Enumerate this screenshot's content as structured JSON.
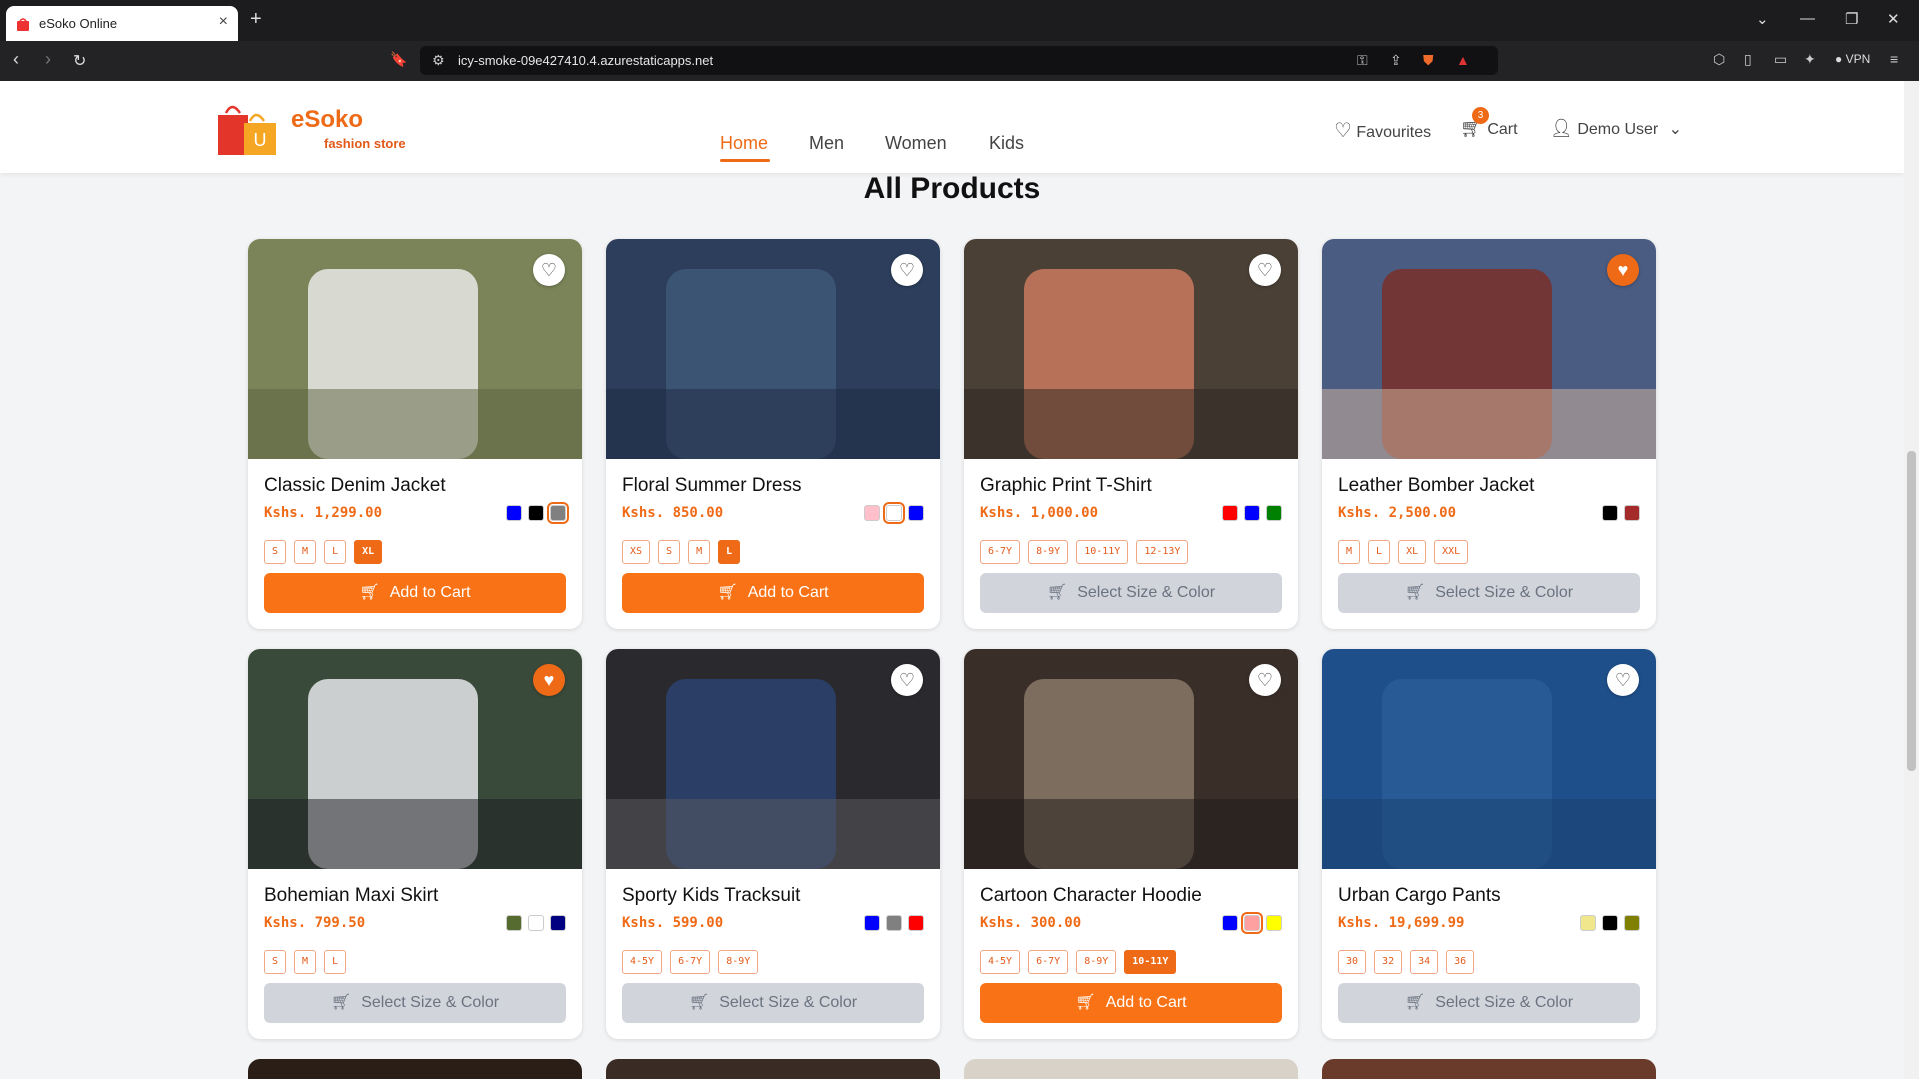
{
  "browser": {
    "tab_title": "eSoko Online",
    "url": "icy-smoke-09e427410.4.azurestaticapps.net",
    "vpn_label": "VPN"
  },
  "header": {
    "brand": "eSoko",
    "tagline": "fashion store",
    "nav": [
      "Home",
      "Men",
      "Women",
      "Kids"
    ],
    "active_nav": "Home",
    "favourites_label": "Favourites",
    "cart_label": "Cart",
    "cart_count": "3",
    "user_label": "Demo User"
  },
  "main": {
    "title": "All Products",
    "products": [
      {
        "name": "Classic Denim Jacket",
        "price": "Kshs. 1,299.00",
        "favourite": false,
        "colors": [
          "#0000ff",
          "#000000",
          "#808080"
        ],
        "selected_color": 2,
        "sizes": [
          "S",
          "M",
          "L",
          "XL"
        ],
        "selected_size": 3,
        "button": "Add to Cart",
        "enabled": true
      },
      {
        "name": "Floral Summer Dress",
        "price": "Kshs. 850.00",
        "favourite": false,
        "colors": [
          "#ffc0cb",
          "#ffffff",
          "#0000ff"
        ],
        "selected_color": 1,
        "sizes": [
          "XS",
          "S",
          "M",
          "L"
        ],
        "selected_size": 3,
        "button": "Add to Cart",
        "enabled": true
      },
      {
        "name": "Graphic Print T-Shirt",
        "price": "Kshs. 1,000.00",
        "favourite": false,
        "colors": [
          "#ff0000",
          "#0000ff",
          "#008000"
        ],
        "selected_color": -1,
        "sizes": [
          "6-7Y",
          "8-9Y",
          "10-11Y",
          "12-13Y"
        ],
        "selected_size": -1,
        "button": "Select Size & Color",
        "enabled": false
      },
      {
        "name": "Leather Bomber Jacket",
        "price": "Kshs. 2,500.00",
        "favourite": true,
        "colors": [
          "#000000",
          "#a52a2a"
        ],
        "selected_color": -1,
        "sizes": [
          "M",
          "L",
          "XL",
          "XXL"
        ],
        "selected_size": -1,
        "button": "Select Size & Color",
        "enabled": false
      },
      {
        "name": "Bohemian Maxi Skirt",
        "price": "Kshs. 799.50",
        "favourite": true,
        "colors": [
          "#556b2f",
          "#ffffff",
          "#000080"
        ],
        "selected_color": -1,
        "sizes": [
          "S",
          "M",
          "L"
        ],
        "selected_size": -1,
        "button": "Select Size & Color",
        "enabled": false
      },
      {
        "name": "Sporty Kids Tracksuit",
        "price": "Kshs. 599.00",
        "favourite": false,
        "colors": [
          "#0000ff",
          "#808080",
          "#ff0000"
        ],
        "selected_color": -1,
        "sizes": [
          "4-5Y",
          "6-7Y",
          "8-9Y"
        ],
        "selected_size": -1,
        "button": "Select Size & Color",
        "enabled": false
      },
      {
        "name": "Cartoon Character Hoodie",
        "price": "Kshs. 300.00",
        "favourite": false,
        "colors": [
          "#0000ff",
          "#ffa0a0",
          "#ffff00"
        ],
        "selected_color": 1,
        "sizes": [
          "4-5Y",
          "6-7Y",
          "8-9Y",
          "10-11Y"
        ],
        "selected_size": 3,
        "button": "Add to Cart",
        "enabled": true
      },
      {
        "name": "Urban Cargo Pants",
        "price": "Kshs. 19,699.99",
        "favourite": false,
        "colors": [
          "#f0e68c",
          "#000000",
          "#808000"
        ],
        "selected_color": -1,
        "sizes": [
          "30",
          "32",
          "34",
          "36"
        ],
        "selected_size": -1,
        "button": "Select Size & Color",
        "enabled": false
      }
    ]
  },
  "colors": {
    "accent": "#ef6a16",
    "button_on": "#f97316",
    "button_off": "#d1d5db"
  }
}
